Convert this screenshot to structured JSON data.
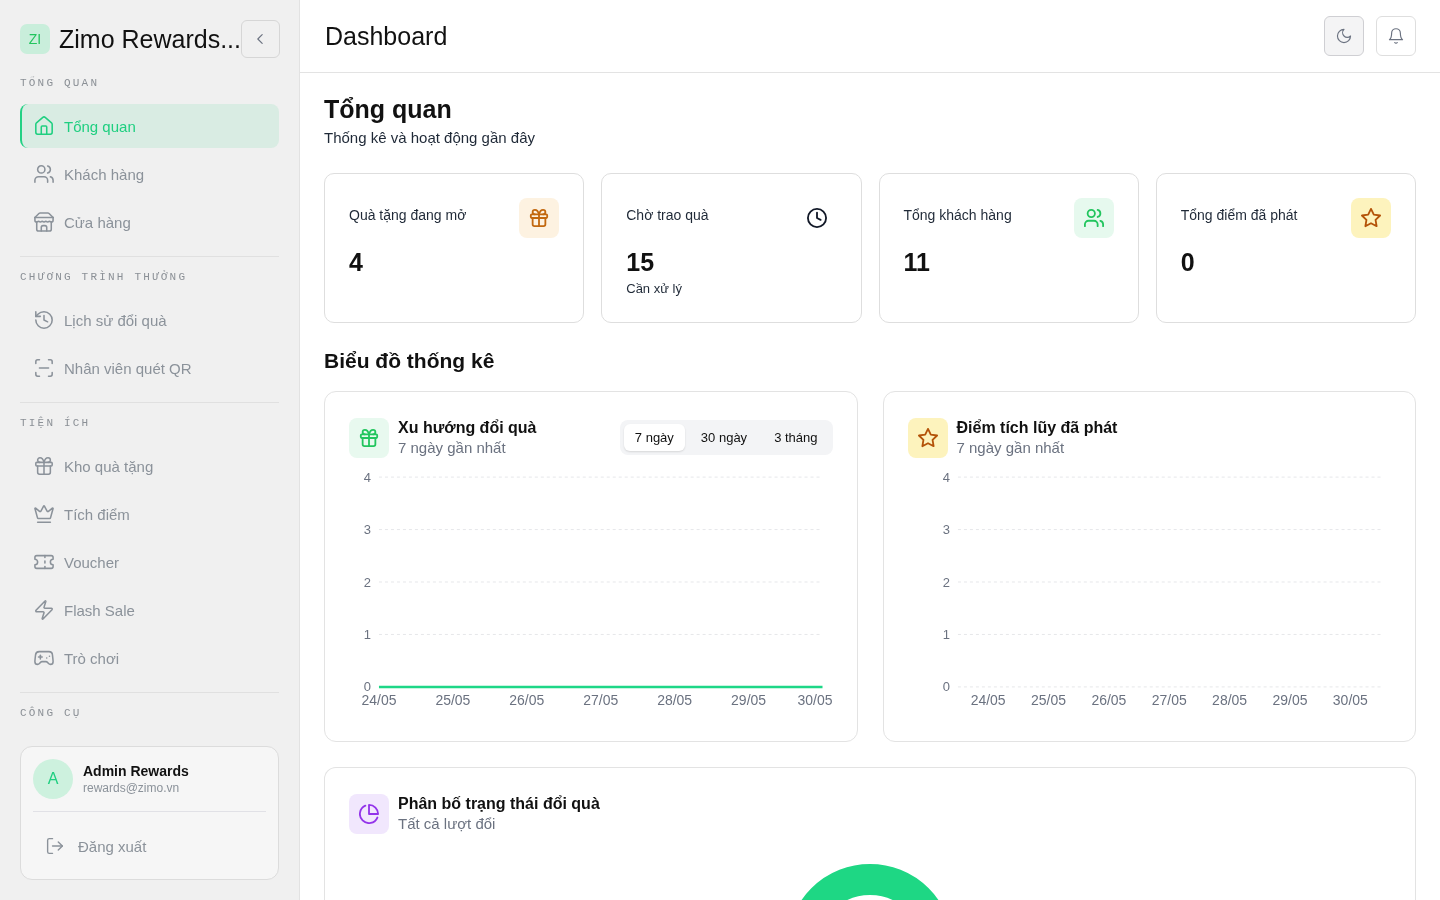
{
  "sidebar": {
    "logo": {
      "badge": "ZI",
      "title": "Zimo Rewards..."
    },
    "sections": [
      {
        "heading": "TỔNG QUAN",
        "items": [
          {
            "label": "Tổng quan",
            "selected": true
          },
          {
            "label": "Khách hàng",
            "selected": false
          },
          {
            "label": "Cửa hàng",
            "selected": false
          }
        ]
      },
      {
        "heading": "CHƯƠNG TRÌNH THƯỞNG",
        "items": [
          {
            "label": "Lịch sử đổi quà",
            "selected": false
          },
          {
            "label": "Nhân viên quét QR",
            "selected": false
          }
        ]
      },
      {
        "heading": "TIỆN ÍCH",
        "items": [
          {
            "label": "Kho quà tặng",
            "selected": false
          },
          {
            "label": "Tích điểm",
            "selected": false
          },
          {
            "label": "Voucher",
            "selected": false
          },
          {
            "label": "Flash Sale",
            "selected": false
          },
          {
            "label": "Trò chơi",
            "selected": false
          }
        ]
      },
      {
        "heading": "CÔNG CỤ"
      }
    ],
    "user": {
      "avatar": "A",
      "name": "Admin Rewards",
      "email": "rewards@zimo.vn",
      "logout": "Đăng xuất"
    }
  },
  "header": {
    "title": "Dashboard"
  },
  "overview": {
    "title": "Tổng quan",
    "subtitle": "Thống kê và hoạt động gần đây",
    "stats": [
      {
        "label": "Quà tặng đang mở",
        "value": "4"
      },
      {
        "label": "Chờ trao quà",
        "value": "15",
        "note": "Cần xử lý"
      },
      {
        "label": "Tổng khách hàng",
        "value": "11"
      },
      {
        "label": "Tổng điểm đã phát",
        "value": "0"
      }
    ]
  },
  "charts": {
    "title": "Biểu đồ thống kê",
    "cards": [
      {
        "title": "Xu hướng đổi quà",
        "subtitle": "7 ngày gần nhất",
        "tabs": [
          {
            "label": "7 ngày",
            "selected": true
          },
          {
            "label": "30 ngày",
            "selected": false
          },
          {
            "label": "3 tháng",
            "selected": false
          }
        ],
        "chart_data": {
          "type": "line",
          "categories": [
            "24/05",
            "25/05",
            "26/05",
            "27/05",
            "28/05",
            "29/05",
            "30/05"
          ],
          "series": [
            {
              "color": "#1ed787",
              "values": [
                0,
                0,
                0,
                0,
                0,
                0,
                0
              ]
            }
          ],
          "ylim": [
            0,
            4
          ],
          "yticks": [
            0,
            1,
            2,
            3,
            4
          ],
          "grid": true
        }
      },
      {
        "title": "Điểm tích lũy đã phát",
        "subtitle": "7 ngày gần nhất",
        "chart_data": {
          "type": "bar",
          "categories": [
            "24/05",
            "25/05",
            "26/05",
            "27/05",
            "28/05",
            "29/05",
            "30/05"
          ],
          "values": [
            0,
            0,
            0,
            0,
            0,
            0,
            0
          ],
          "ylim": [
            0,
            4
          ],
          "yticks": [
            0,
            1,
            2,
            3,
            4
          ],
          "grid": true
        }
      }
    ]
  },
  "distribution": {
    "title": "Phân bố trạng thái đổi quà",
    "subtitle": "Tất cả lượt đổi"
  }
}
